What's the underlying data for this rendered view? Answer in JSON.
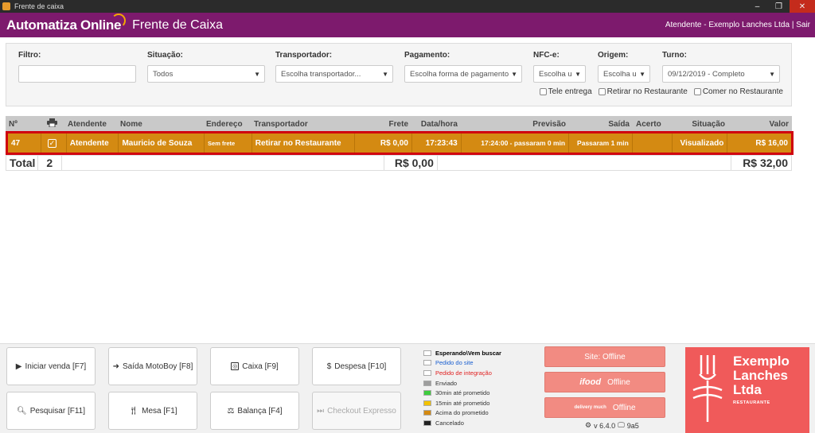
{
  "window": {
    "title": "Frente de caixa",
    "controls": [
      "–",
      "❐",
      "✕"
    ]
  },
  "header": {
    "logo": "Automatiza Online",
    "page_title": "Frente de Caixa",
    "user": "Atendente - Exemplo Lanches Ltda | Sair"
  },
  "filters": {
    "filtro": {
      "label": "Filtro:",
      "value": ""
    },
    "situacao": {
      "label": "Situação:",
      "value": "Todos"
    },
    "transportador": {
      "label": "Transportador:",
      "value": "Escolha transportador..."
    },
    "pagamento": {
      "label": "Pagamento:",
      "value": "Escolha forma de pagamento"
    },
    "nfce": {
      "label": "NFC-e:",
      "value": "Escolha u"
    },
    "origem": {
      "label": "Origem:",
      "value": "Escolha u"
    },
    "turno": {
      "label": "Turno:",
      "value": "09/12/2019 - Completo"
    },
    "checks": [
      "Tele entrega",
      "Retirar no Restaurante",
      "Comer no Restaurante"
    ]
  },
  "table": {
    "headers": {
      "numero": "Nº",
      "atendente": "Atendente",
      "nome": "Nome",
      "endereco": "Endereço",
      "transportador": "Transportador",
      "frete": "Frete",
      "datahora": "Data/hora",
      "previsao": "Previsão",
      "saida": "Saída",
      "acerto": "Acerto",
      "situacao": "Situação",
      "valor": "Valor"
    },
    "row": {
      "numero": "47",
      "atendente": "Atendente",
      "nome": "Mauricio de Souza",
      "endereco": "Sem frete",
      "transportador": "Retirar no Restaurante",
      "frete": "R$ 0,00",
      "datahora": "17:23:43",
      "previsao": "17:24:00 - passaram 0 min",
      "saida": "Passaram 1 min",
      "acerto": "",
      "situacao": "Visualizado",
      "valor": "R$ 16,00"
    },
    "total": {
      "label": "Total",
      "count": "2",
      "frete": "R$ 0,00",
      "valor": "R$ 32,00"
    }
  },
  "actions": {
    "iniciar_venda": "Iniciar venda [F7]",
    "saida_motoboy": "Saída MotoBoy [F8]",
    "caixa": "Caixa [F9]",
    "despesa": "Despesa [F10]",
    "pesquisar": "Pesquisar [F11]",
    "mesa": "Mesa [F1]",
    "balanca": "Balança [F4]",
    "checkout": "Checkout Expresso"
  },
  "legend": [
    {
      "label": "Esperando\\Vem buscar",
      "color": "#ffffff",
      "text_color": "#000000",
      "bold": true
    },
    {
      "label": "Pedido do site",
      "color": "#ffffff",
      "text_color": "#1a5fd0"
    },
    {
      "label": "Pedido de integração",
      "color": "#ffffff",
      "text_color": "#e02020"
    },
    {
      "label": "Enviado",
      "color": "#9e9e9e",
      "text_color": "#333333"
    },
    {
      "label": "30min até prometido",
      "color": "#3ecb3e",
      "text_color": "#333333"
    },
    {
      "label": "15min até prometido",
      "color": "#f2c200",
      "text_color": "#333333"
    },
    {
      "label": "Acima do prometido",
      "color": "#d48a12",
      "text_color": "#333333"
    },
    {
      "label": "Cancelado",
      "color": "#222222",
      "text_color": "#333333"
    }
  ],
  "integrations": {
    "site": "Site: Offline",
    "ifood_logo": "ifood",
    "ifood": "Offline",
    "delivery_logo": "delivery much",
    "delivery": "Offline"
  },
  "version": {
    "number": "v 6.4.0",
    "build": "9a5"
  },
  "brand": {
    "name_line1": "Exemplo",
    "name_line2": "Lanches",
    "name_line3": "Ltda",
    "subtitle": "RESTAURANTE"
  },
  "colors": {
    "header": "#7d1a6d",
    "row_late": "#d48a12",
    "selection": "#d0000e",
    "brand": "#f05a5a",
    "offline": "#f28b82"
  }
}
